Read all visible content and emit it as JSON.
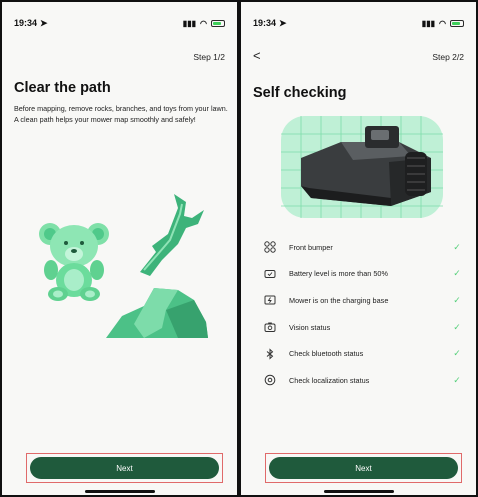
{
  "left_screen": {
    "status_time": "19:34",
    "step": "Step 1/2",
    "title": "Clear the path",
    "description": "Before mapping, remove rocks, branches, and toys from your lawn. A clean path helps your mower map smoothly and safely!",
    "next_label": "Next"
  },
  "right_screen": {
    "status_time": "19:34",
    "back_label": "<",
    "step": "Step 2/2",
    "title": "Self checking",
    "checks": [
      {
        "label": "Front bumper",
        "icon": "bumper-icon"
      },
      {
        "label": "Battery level is more than 50%",
        "icon": "battery-icon"
      },
      {
        "label": "Mower is on the charging base",
        "icon": "charging-icon"
      },
      {
        "label": "Vision status",
        "icon": "camera-icon"
      },
      {
        "label": "Check bluetooth status",
        "icon": "bluetooth-icon"
      },
      {
        "label": "Check localization status",
        "icon": "location-icon"
      }
    ],
    "check_mark": "✓",
    "next_label": "Next"
  },
  "colors": {
    "accent_green": "#1f5a3c",
    "light_green": "#56d07b",
    "highlight_red": "#e06a6a"
  }
}
